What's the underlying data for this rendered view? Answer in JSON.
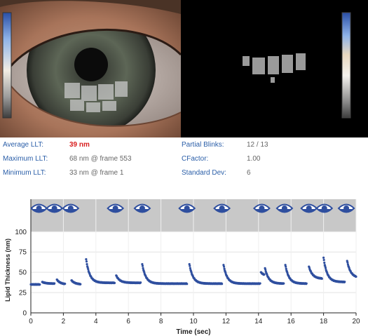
{
  "metrics": {
    "average_llt": {
      "label": "Average LLT:",
      "value": "39 nm"
    },
    "maximum_llt": {
      "label": "Maximum LLT:",
      "value": "68 nm @ frame 553"
    },
    "minimum_llt": {
      "label": "Minimum LLT:",
      "value": "33 nm @ frame 1"
    },
    "partial_blinks": {
      "label": "Partial Blinks:",
      "value": "12 / 13"
    },
    "cfactor": {
      "label": "CFactor:",
      "value": "1.00"
    },
    "standard_dev": {
      "label": "Standard Dev:",
      "value": "6"
    }
  },
  "colors": {
    "label_blue": "#2a5ea8",
    "value_red": "#d81e1e",
    "point_blue": "#2f4f9f",
    "blink_band": "#c8c8c8"
  },
  "icons": {
    "blink": "eye-icon"
  },
  "chart_data": {
    "type": "scatter",
    "xlabel": "Time (sec)",
    "ylabel": "Lipid Thickness (nm)",
    "xlim": [
      0,
      20
    ],
    "ylim": [
      0,
      140
    ],
    "xticks": [
      "0",
      "2",
      "4",
      "6",
      "8",
      "10",
      "12",
      "14",
      "16",
      "18",
      "20"
    ],
    "yticks": [
      "0",
      "25",
      "50",
      "75",
      "100"
    ],
    "blink_times": [
      0.5,
      1.45,
      2.45,
      5.2,
      6.85,
      9.6,
      11.75,
      14.2,
      15.6,
      17.1,
      18.05,
      19.4
    ],
    "segments": [
      {
        "start": 0.0,
        "end": 0.55,
        "peak": 35,
        "base": 35
      },
      {
        "start": 0.7,
        "end": 1.45,
        "peak": 38,
        "base": 36
      },
      {
        "start": 1.6,
        "end": 2.1,
        "peak": 41,
        "base": 35
      },
      {
        "start": 2.5,
        "end": 3.05,
        "peak": 40,
        "base": 35
      },
      {
        "start": 3.4,
        "end": 5.15,
        "peak": 66,
        "base": 37
      },
      {
        "start": 5.25,
        "end": 6.75,
        "peak": 46,
        "base": 37
      },
      {
        "start": 6.85,
        "end": 9.6,
        "peak": 60,
        "base": 36
      },
      {
        "start": 9.75,
        "end": 11.75,
        "peak": 60,
        "base": 36
      },
      {
        "start": 11.85,
        "end": 14.1,
        "peak": 59,
        "base": 36
      },
      {
        "start": 14.15,
        "end": 14.35,
        "peak": 50,
        "base": 45
      },
      {
        "start": 14.4,
        "end": 15.55,
        "peak": 55,
        "base": 36
      },
      {
        "start": 15.65,
        "end": 16.95,
        "peak": 59,
        "base": 36
      },
      {
        "start": 17.1,
        "end": 17.9,
        "peak": 57,
        "base": 42
      },
      {
        "start": 18.0,
        "end": 19.3,
        "peak": 68,
        "base": 38
      },
      {
        "start": 19.45,
        "end": 20.0,
        "peak": 64,
        "base": 43
      }
    ]
  }
}
